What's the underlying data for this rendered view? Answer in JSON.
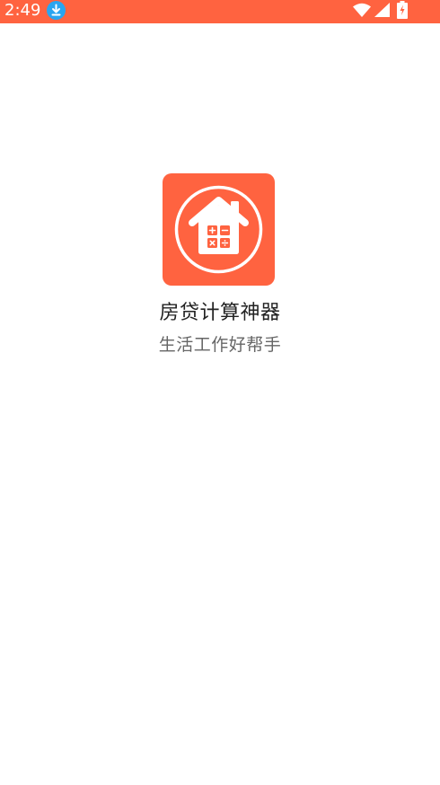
{
  "status_bar": {
    "time": "2:49",
    "notification_icon": "download-icon",
    "icons": [
      "wifi-icon",
      "signal-icon",
      "battery-charging-icon"
    ],
    "background_color": "#ff6340"
  },
  "splash": {
    "logo_icon": "house-calculator-icon",
    "logo_color": "#ff6340",
    "app_name": "房贷计算神器",
    "slogan": "生活工作好帮手"
  }
}
